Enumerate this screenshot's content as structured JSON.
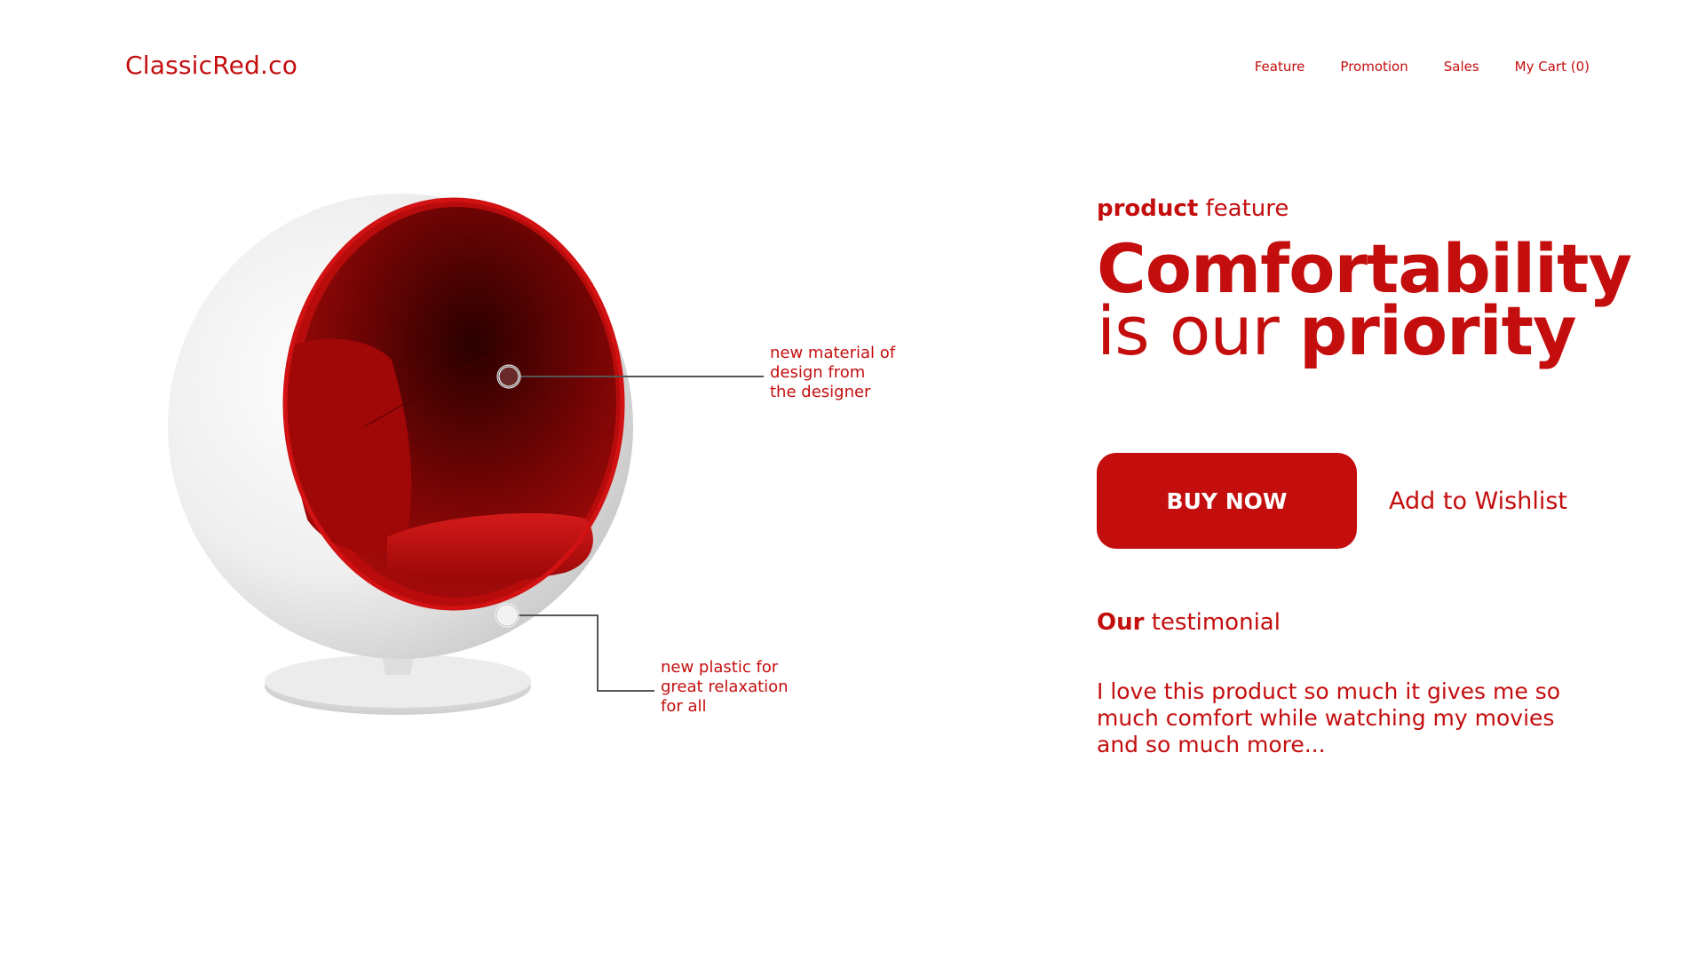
{
  "brand": {
    "logo_text": "ClassicRed.co"
  },
  "nav": {
    "items": [
      {
        "label": "Feature"
      },
      {
        "label": "Promotion"
      },
      {
        "label": "Sales"
      },
      {
        "label": "My Cart (0)"
      }
    ]
  },
  "product": {
    "image_name": "ball-chair-image",
    "callouts": [
      {
        "text": "new material of\ndesign from\nthe designer"
      },
      {
        "text": "new plastic for\ngreat relaxation\nfor all"
      }
    ]
  },
  "hero": {
    "eyebrow_bold": "product",
    "eyebrow_rest": " feature",
    "headline_line1": "Comfortability",
    "headline_line2_light": "is our ",
    "headline_line2_bold": "priority"
  },
  "actions": {
    "buy_label": "BUY NOW",
    "wishlist_label": "Add to Wishlist"
  },
  "testimonial": {
    "title_bold": "Our",
    "title_rest": " testimonial",
    "text": "I love this product so much it gives me so much comfort while watching my movies and so much more..."
  },
  "colors": {
    "accent": "#c40e0e",
    "background": "#ffffff"
  }
}
